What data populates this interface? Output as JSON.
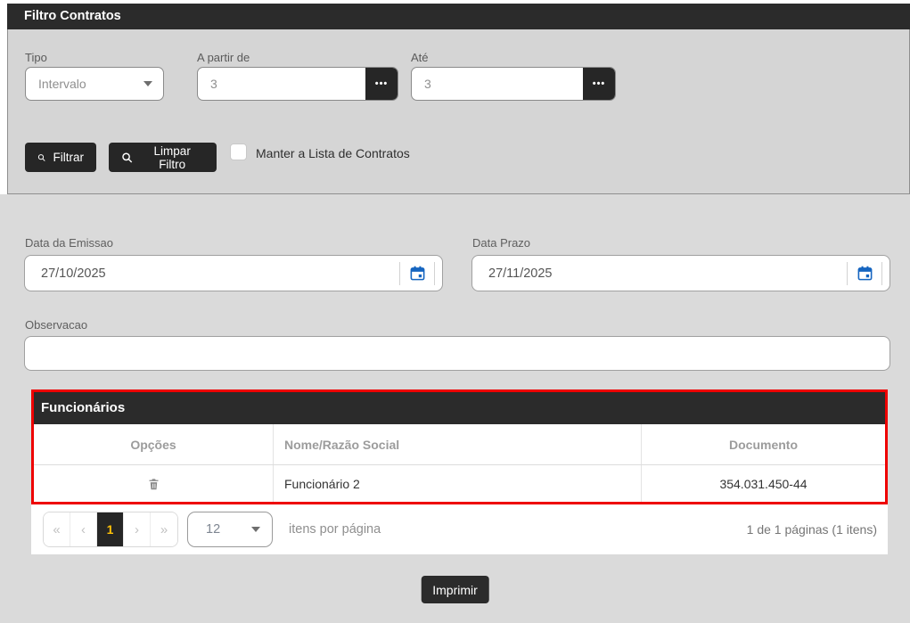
{
  "colors": {
    "dark_bar": "#2b2b2b",
    "panel_gray": "#d5d5d5",
    "page_gray": "#dadada",
    "highlight_red": "#ee0000",
    "calendar_blue": "#1565c0",
    "active_page_text": "#ffc107"
  },
  "icons": {
    "ellipsis": "•••",
    "pager_first": "«",
    "pager_prev": "‹",
    "pager_next": "›",
    "pager_last": "»"
  },
  "filter_panel": {
    "title": "Filtro Contratos",
    "tipo": {
      "label": "Tipo",
      "value": "Intervalo"
    },
    "a_partir_de": {
      "label": "A partir de",
      "value": "3"
    },
    "ate": {
      "label": "Até",
      "value": "3"
    },
    "filtrar_label": "Filtrar",
    "limpar_label": "Limpar Filtro",
    "checkbox_label": "Manter a Lista de Contratos",
    "checkbox_checked": false
  },
  "dates": {
    "emissao": {
      "label": "Data da Emissao",
      "value": "27/10/2025"
    },
    "prazo": {
      "label": "Data Prazo",
      "value": "27/11/2025"
    }
  },
  "observacao": {
    "label": "Observacao",
    "value": ""
  },
  "funcionarios": {
    "title": "Funcionários",
    "columns": [
      "Opções",
      "Nome/Razão Social",
      "Documento"
    ],
    "rows": [
      {
        "nome": "Funcionário 2",
        "documento": "354.031.450-44"
      }
    ]
  },
  "pagination": {
    "current_page": "1",
    "page_size": "12",
    "items_per_page_label": "itens por página",
    "summary": "1 de 1 páginas (1 itens)"
  },
  "footer": {
    "imprimir_label": "Imprimir"
  }
}
